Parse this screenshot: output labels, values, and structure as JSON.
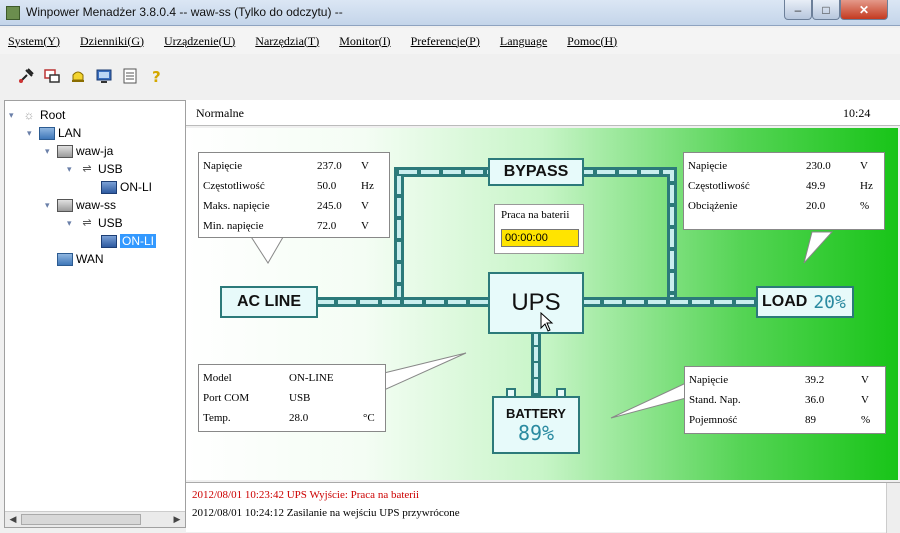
{
  "window": {
    "title": "Winpower Menadżer 3.8.0.4 -- waw-ss (Tylko do odczytu) --",
    "min": "–",
    "max": "□",
    "close": "✕"
  },
  "menu": [
    "System(Y)",
    "Dzienniki(G)",
    "Urządzenie(U)",
    "Narzędzia(T)",
    "Monitor(I)",
    "Preferencje(P)",
    "Language",
    "Pomoc(H)"
  ],
  "toolbar": [
    "wrench-icon",
    "network-icon",
    "bell-icon",
    "monitor-icon",
    "list-icon",
    "help-icon"
  ],
  "tree": {
    "root": "Root",
    "lan": "LAN",
    "host1": "waw-ja",
    "usb1": "USB",
    "ups1": "ON-LI",
    "host2": "waw-ss",
    "usb2": "USB",
    "ups2": "ON-LI",
    "wan": "WAN"
  },
  "status": {
    "mode": "Normalne",
    "time": "10:24"
  },
  "input_panel": {
    "rows": [
      {
        "label": "Napięcie",
        "value": "237.0",
        "unit": "V"
      },
      {
        "label": "Częstotliwość",
        "value": "50.0",
        "unit": "Hz"
      },
      {
        "label": "Maks. napięcie",
        "value": "245.0",
        "unit": "V"
      },
      {
        "label": "Min. napięcie",
        "value": "72.0",
        "unit": "V"
      }
    ]
  },
  "output_panel": {
    "rows": [
      {
        "label": "Napięcie",
        "value": "230.0",
        "unit": "V"
      },
      {
        "label": "Częstotliwość",
        "value": "49.9",
        "unit": "Hz"
      },
      {
        "label": "Obciążenie",
        "value": "20.0",
        "unit": "%"
      }
    ]
  },
  "device_panel": {
    "rows": [
      {
        "label": "Model",
        "value": "ON-LINE",
        "unit": ""
      },
      {
        "label": "Port COM",
        "value": "USB",
        "unit": ""
      },
      {
        "label": "Temp.",
        "value": "28.0",
        "unit": "°C"
      }
    ]
  },
  "battery_panel": {
    "rows": [
      {
        "label": "Napięcie",
        "value": "39.2",
        "unit": "V"
      },
      {
        "label": "Stand. Nap.",
        "value": "36.0",
        "unit": "V"
      },
      {
        "label": "Pojemność",
        "value": "89",
        "unit": "%"
      }
    ]
  },
  "diagram": {
    "bypass": "BYPASS",
    "ac_line": "AC LINE",
    "ups": "UPS",
    "load": "LOAD",
    "load_percent": "20%",
    "battery": "BATTERY",
    "battery_percent": "89%",
    "timer_label": "Praca na baterii",
    "timer_value": "00:00:00"
  },
  "log": [
    {
      "text": "2012/08/01 10:23:42  UPS Wyjście: Praca na baterii",
      "color": "#cc0000"
    },
    {
      "text": "2012/08/01 10:24:12  Zasilanie na wejściu UPS przywrócone",
      "color": "#000000"
    }
  ],
  "colors": {
    "accent_green": "#18c418",
    "line_teal": "#2c7a7a",
    "timer_yellow": "#ffe400"
  }
}
